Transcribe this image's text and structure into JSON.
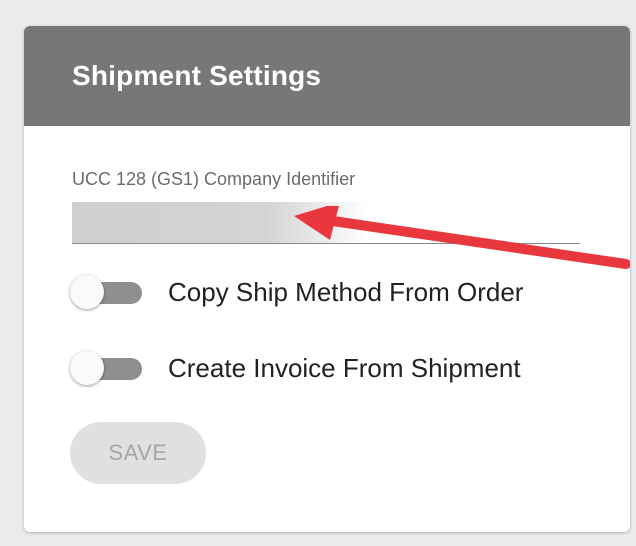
{
  "card": {
    "title": "Shipment Settings"
  },
  "company_identifier": {
    "label": "UCC 128 (GS1) Company Identifier",
    "value": ""
  },
  "toggles": [
    {
      "label": "Copy Ship Method From Order",
      "checked": false
    },
    {
      "label": "Create Invoice From Shipment",
      "checked": false
    }
  ],
  "actions": {
    "save_label": "SAVE",
    "save_enabled": false
  },
  "colors": {
    "header_bg": "#777777",
    "annotation_arrow": "#e8383d",
    "toggle_track_off": "#8f8f8f",
    "save_bg_disabled": "#e0e0e0"
  },
  "icons": {
    "annotation": "red-arrow-icon"
  }
}
